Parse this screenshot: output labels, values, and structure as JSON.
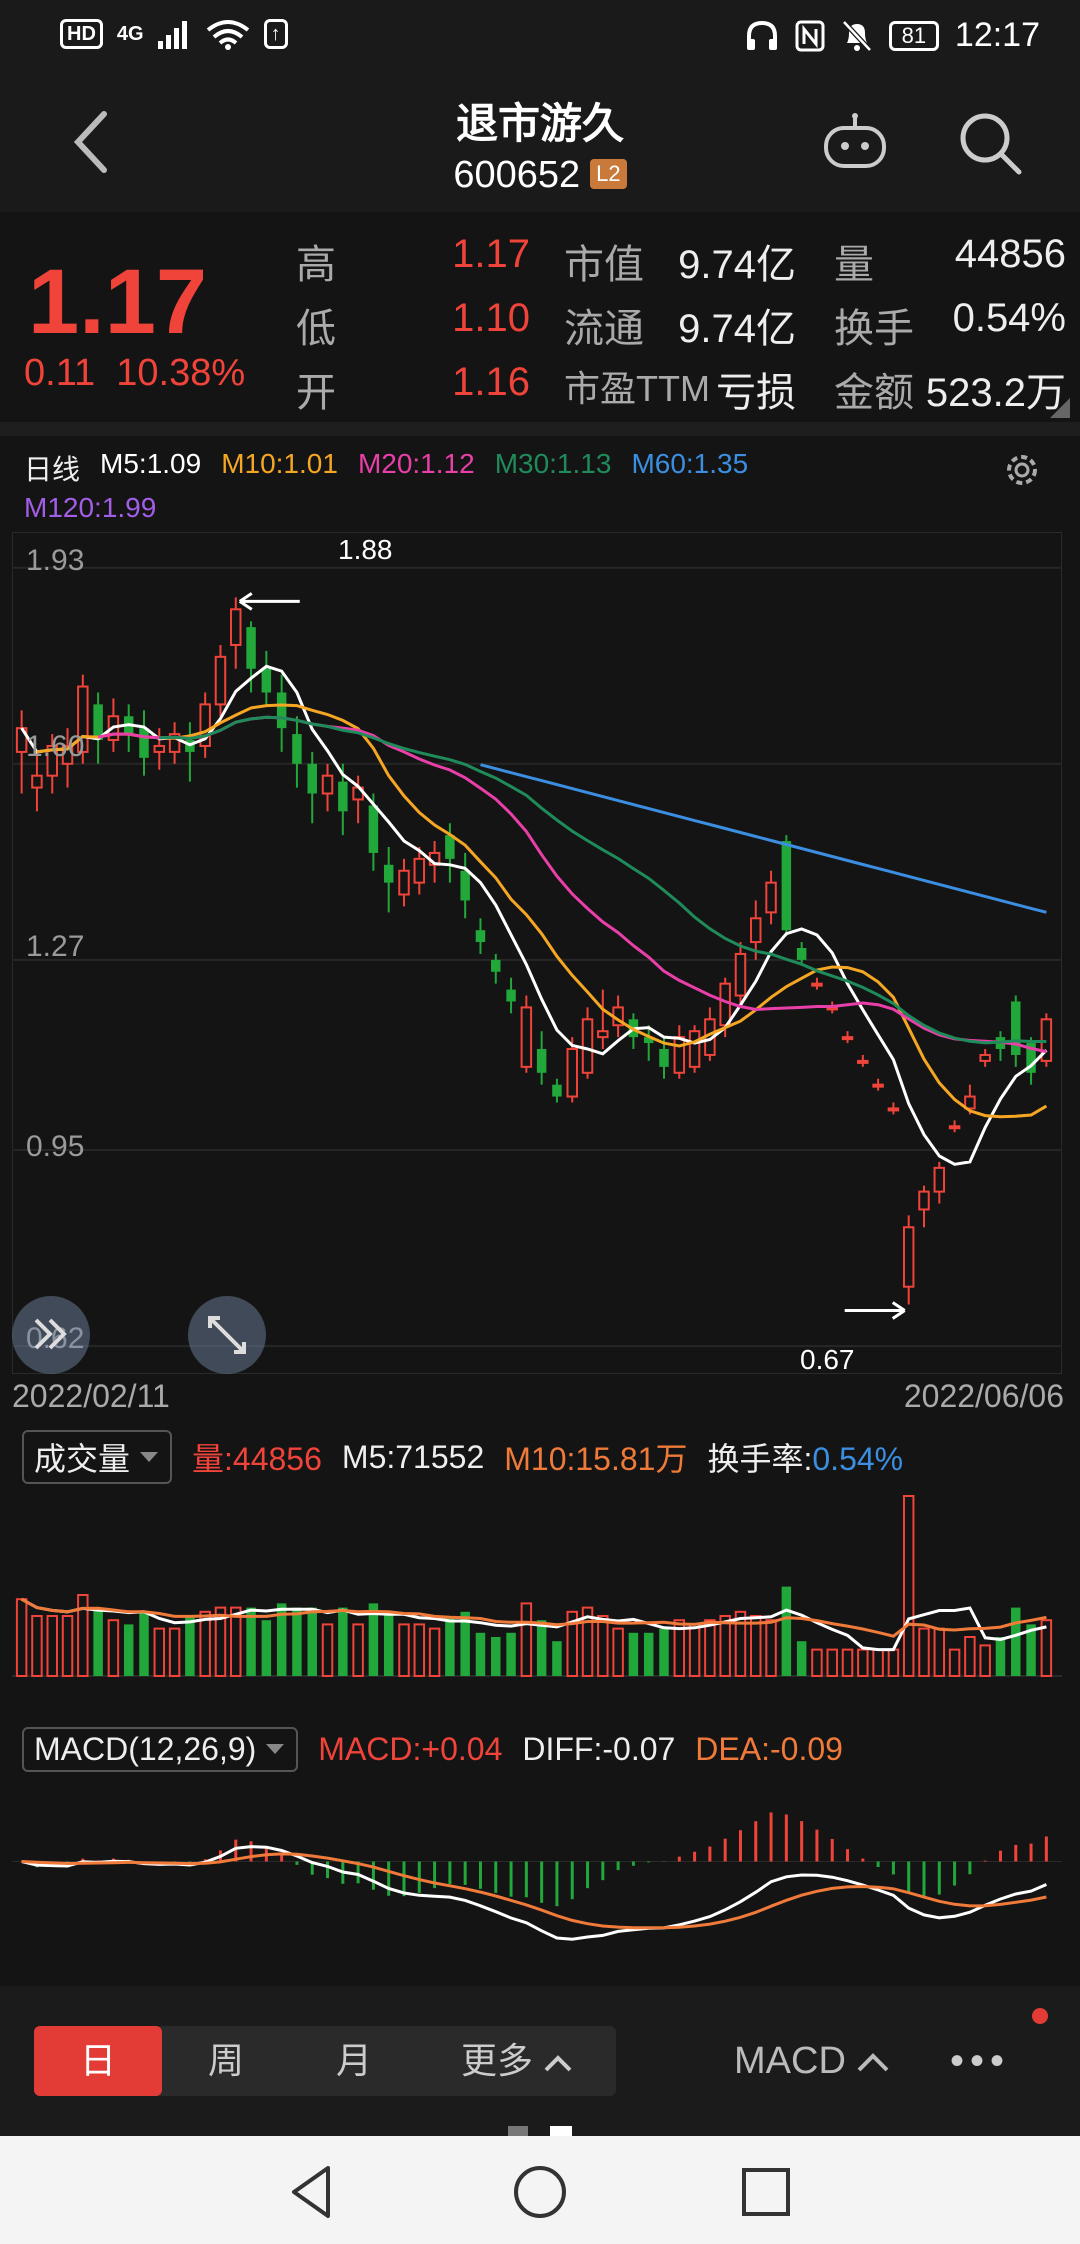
{
  "status": {
    "left": [
      "HD",
      "4G",
      "↑"
    ],
    "battery": "81",
    "time": "12:17"
  },
  "header": {
    "name": "退市游久",
    "code": "600652",
    "badge": "L2"
  },
  "quote": {
    "price": "1.17",
    "change": "0.11",
    "change_pct": "10.38%",
    "high_label": "高",
    "high": "1.17",
    "low_label": "低",
    "low": "1.10",
    "open_label": "开",
    "open": "1.16",
    "mcap_label": "市值",
    "mcap": "9.74亿",
    "float_label": "流通",
    "float": "9.74亿",
    "pe_label": "市盈TTM",
    "pe": "亏损",
    "vol_label": "量",
    "vol": "44856",
    "turnover_label": "换手",
    "turnover": "0.54%",
    "amount_label": "金额",
    "amount": "523.2万"
  },
  "ma": {
    "period": "日线",
    "m5": "M5:1.09",
    "m10": "M10:1.01",
    "m20": "M20:1.12",
    "m30": "M30:1.13",
    "m60": "M60:1.35",
    "m120": "M120:1.99"
  },
  "colors": {
    "up": "#f0443a",
    "down": "#22a83a",
    "m5": "#ffffff",
    "m10": "#f5a623",
    "m20": "#e83fa8",
    "m30": "#1f8a5a",
    "m60": "#3b8ee0",
    "m120": "#a35ee8"
  },
  "kline": {
    "ticks": [
      "1.93",
      "1.60",
      "1.27",
      "0.95",
      "0.62"
    ],
    "high_mark": "1.88",
    "low_mark": "0.67",
    "date_start": "2022/02/11",
    "date_end": "2022/06/06"
  },
  "volume": {
    "selector": "成交量",
    "vol": "量:44856",
    "m5": "M5:71552",
    "m10": "M10:15.81万",
    "turnover_label": "换手率:",
    "turnover": "0.54%"
  },
  "macd": {
    "selector": "MACD(12,26,9)",
    "macd": "MACD:+0.04",
    "diff": "DIFF:-0.07",
    "dea": "DEA:-0.09"
  },
  "periods": {
    "day": "日",
    "week": "周",
    "month": "月",
    "more": "更多",
    "indicator": "MACD",
    "dots": "•••"
  },
  "chart_data": {
    "type": "candlestick",
    "x_start": "2022/02/11",
    "x_end": "2022/06/06",
    "y_ticks": [
      1.93,
      1.6,
      1.27,
      0.95,
      0.62
    ],
    "ylim": [
      0.6,
      1.98
    ],
    "candles": [
      [
        1.62,
        1.66,
        1.55,
        1.69
      ],
      [
        1.56,
        1.58,
        1.52,
        1.62
      ],
      [
        1.58,
        1.63,
        1.55,
        1.65
      ],
      [
        1.6,
        1.63,
        1.56,
        1.66
      ],
      [
        1.62,
        1.73,
        1.6,
        1.75
      ],
      [
        1.7,
        1.64,
        1.6,
        1.72
      ],
      [
        1.64,
        1.68,
        1.62,
        1.71
      ],
      [
        1.68,
        1.65,
        1.62,
        1.7
      ],
      [
        1.66,
        1.61,
        1.58,
        1.69
      ],
      [
        1.62,
        1.63,
        1.59,
        1.66
      ],
      [
        1.62,
        1.65,
        1.6,
        1.67
      ],
      [
        1.64,
        1.62,
        1.57,
        1.67
      ],
      [
        1.63,
        1.7,
        1.61,
        1.72
      ],
      [
        1.7,
        1.78,
        1.68,
        1.8
      ],
      [
        1.8,
        1.86,
        1.76,
        1.88
      ],
      [
        1.83,
        1.76,
        1.72,
        1.84
      ],
      [
        1.76,
        1.72,
        1.7,
        1.79
      ],
      [
        1.72,
        1.66,
        1.62,
        1.75
      ],
      [
        1.65,
        1.6,
        1.56,
        1.68
      ],
      [
        1.6,
        1.55,
        1.5,
        1.62
      ],
      [
        1.55,
        1.58,
        1.52,
        1.6
      ],
      [
        1.57,
        1.52,
        1.48,
        1.6
      ],
      [
        1.54,
        1.56,
        1.5,
        1.58
      ],
      [
        1.53,
        1.45,
        1.42,
        1.55
      ],
      [
        1.43,
        1.4,
        1.35,
        1.46
      ],
      [
        1.38,
        1.42,
        1.36,
        1.44
      ],
      [
        1.4,
        1.44,
        1.38,
        1.46
      ],
      [
        1.43,
        1.45,
        1.4,
        1.47
      ],
      [
        1.48,
        1.44,
        1.4,
        1.5
      ],
      [
        1.42,
        1.37,
        1.34,
        1.45
      ],
      [
        1.32,
        1.3,
        1.28,
        1.34
      ],
      [
        1.27,
        1.25,
        1.23,
        1.28
      ],
      [
        1.22,
        1.2,
        1.18,
        1.24
      ],
      [
        1.09,
        1.19,
        1.08,
        1.21
      ],
      [
        1.12,
        1.08,
        1.06,
        1.15
      ],
      [
        1.06,
        1.04,
        1.03,
        1.07
      ],
      [
        1.04,
        1.12,
        1.03,
        1.14
      ],
      [
        1.08,
        1.17,
        1.07,
        1.19
      ],
      [
        1.14,
        1.15,
        1.12,
        1.22
      ],
      [
        1.16,
        1.19,
        1.14,
        1.21
      ],
      [
        1.17,
        1.14,
        1.12,
        1.18
      ],
      [
        1.14,
        1.13,
        1.1,
        1.16
      ],
      [
        1.12,
        1.09,
        1.07,
        1.14
      ],
      [
        1.08,
        1.14,
        1.07,
        1.16
      ],
      [
        1.09,
        1.15,
        1.08,
        1.16
      ],
      [
        1.11,
        1.17,
        1.1,
        1.19
      ],
      [
        1.16,
        1.23,
        1.14,
        1.24
      ],
      [
        1.21,
        1.28,
        1.19,
        1.3
      ],
      [
        1.3,
        1.34,
        1.27,
        1.37
      ],
      [
        1.35,
        1.4,
        1.33,
        1.42
      ],
      [
        1.47,
        1.32,
        1.31,
        1.48
      ],
      [
        1.29,
        1.27,
        1.26,
        1.3
      ],
      [
        1.23,
        1.23,
        1.22,
        1.24
      ],
      [
        1.19,
        1.19,
        1.18,
        1.2
      ],
      [
        1.14,
        1.14,
        1.13,
        1.15
      ],
      [
        1.1,
        1.1,
        1.09,
        1.11
      ],
      [
        1.06,
        1.06,
        1.05,
        1.07
      ],
      [
        1.02,
        1.02,
        1.01,
        1.03
      ],
      [
        0.72,
        0.82,
        0.69,
        0.84
      ],
      [
        0.85,
        0.88,
        0.82,
        0.89
      ],
      [
        0.88,
        0.92,
        0.86,
        0.93
      ],
      [
        0.99,
        0.99,
        0.98,
        1.0
      ],
      [
        1.02,
        1.04,
        1.01,
        1.06
      ],
      [
        1.1,
        1.11,
        1.09,
        1.12
      ],
      [
        1.14,
        1.12,
        1.1,
        1.15
      ],
      [
        1.2,
        1.11,
        1.09,
        1.21
      ],
      [
        1.13,
        1.08,
        1.06,
        1.14
      ],
      [
        1.1,
        1.17,
        1.09,
        1.18
      ]
    ]
  }
}
